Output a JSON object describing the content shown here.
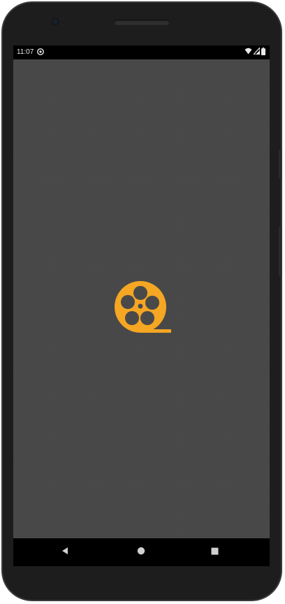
{
  "status_bar": {
    "time": "11:07",
    "notification_icon": "sync-circle-icon",
    "wifi_icon": "wifi-icon",
    "signal_icon": "signal-icon",
    "battery_icon": "battery-icon"
  },
  "app": {
    "logo_icon": "film-reel-icon",
    "logo_color": "#F5A623",
    "background_color": "#494949"
  },
  "nav_bar": {
    "back_icon": "back-triangle-icon",
    "home_icon": "home-circle-icon",
    "recents_icon": "recents-square-icon"
  }
}
